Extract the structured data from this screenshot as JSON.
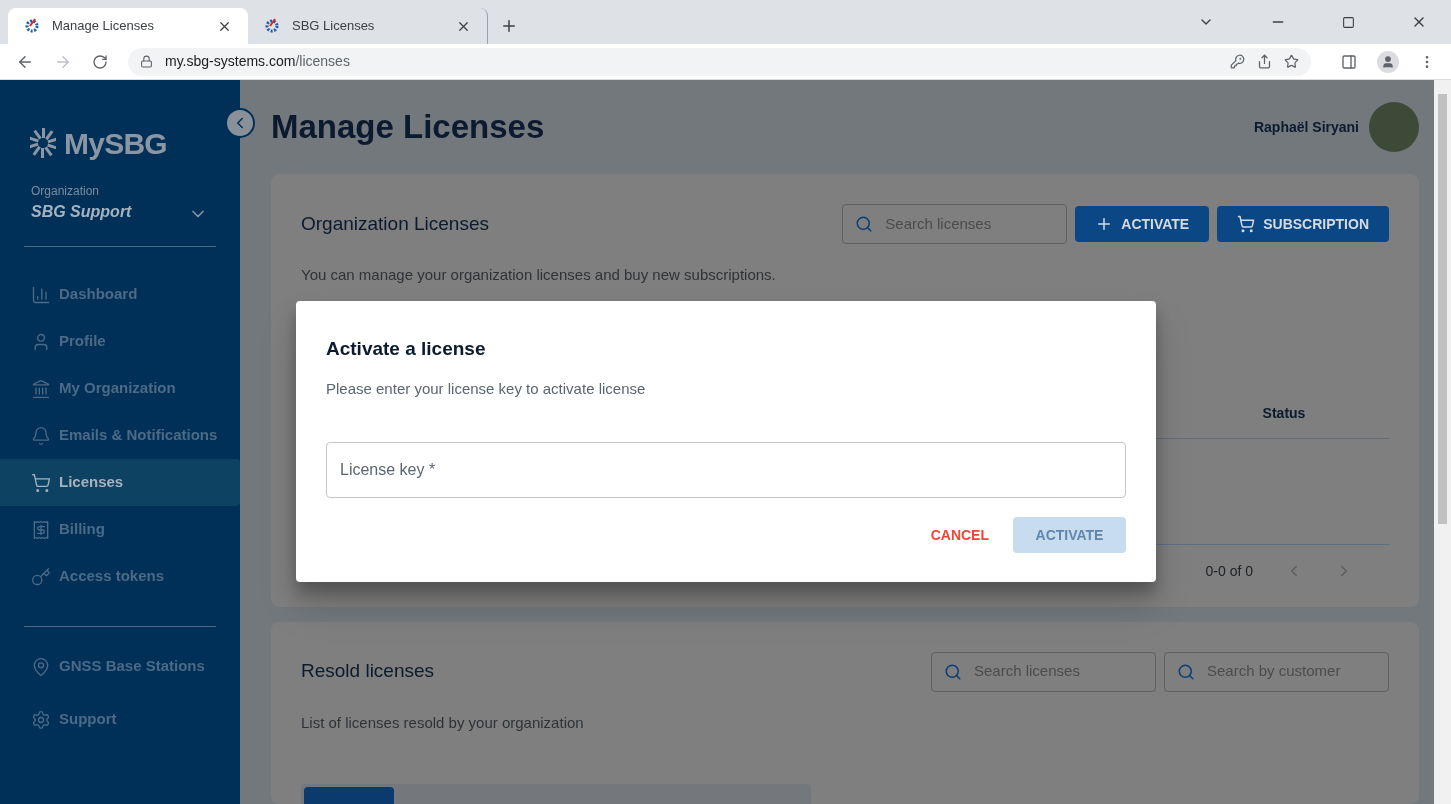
{
  "browser": {
    "tabs": [
      {
        "title": "Manage Licenses",
        "selected": true
      },
      {
        "title": "SBG Licenses",
        "selected": false
      }
    ],
    "url_host": "my.sbg-systems.com",
    "url_path": "/licenses"
  },
  "sidebar": {
    "logo": "MySBG",
    "org_label": "Organization",
    "org_name": "SBG Support",
    "items": [
      {
        "label": "Dashboard",
        "selected": false
      },
      {
        "label": "Profile",
        "selected": false
      },
      {
        "label": "My Organization",
        "selected": false
      },
      {
        "label": "Emails & Notifications",
        "selected": false
      },
      {
        "label": "Licenses",
        "selected": true
      },
      {
        "label": "Billing",
        "selected": false
      },
      {
        "label": "Access tokens",
        "selected": false
      }
    ],
    "bottom_items": [
      {
        "label": "GNSS Base Stations",
        "selected": false
      },
      {
        "label": "Support",
        "selected": false
      }
    ]
  },
  "header": {
    "title": "Manage Licenses",
    "user": "Raphaël Siryani"
  },
  "org_licenses": {
    "title": "Organization Licenses",
    "subtitle": "You can manage your organization licenses and buy new subscriptions.",
    "search_placeholder": "Search licenses",
    "buttons": [
      "ACTIVATE",
      "SUBSCRIPTION"
    ],
    "columns": [
      "Status"
    ],
    "pagination": "0-0 of 0"
  },
  "resold": {
    "title": "Resold licenses",
    "subtitle": "List of licenses resold by your organization",
    "search_placeholders": [
      "Search licenses",
      "Search by customer"
    ]
  },
  "dialog": {
    "title": "Activate a license",
    "text": "Please enter your license key to activate license",
    "field": {
      "placeholder": "License key *"
    },
    "cancel": "CANCEL",
    "confirm": {
      "label": "ACTIVATE",
      "disabled": true
    }
  }
}
